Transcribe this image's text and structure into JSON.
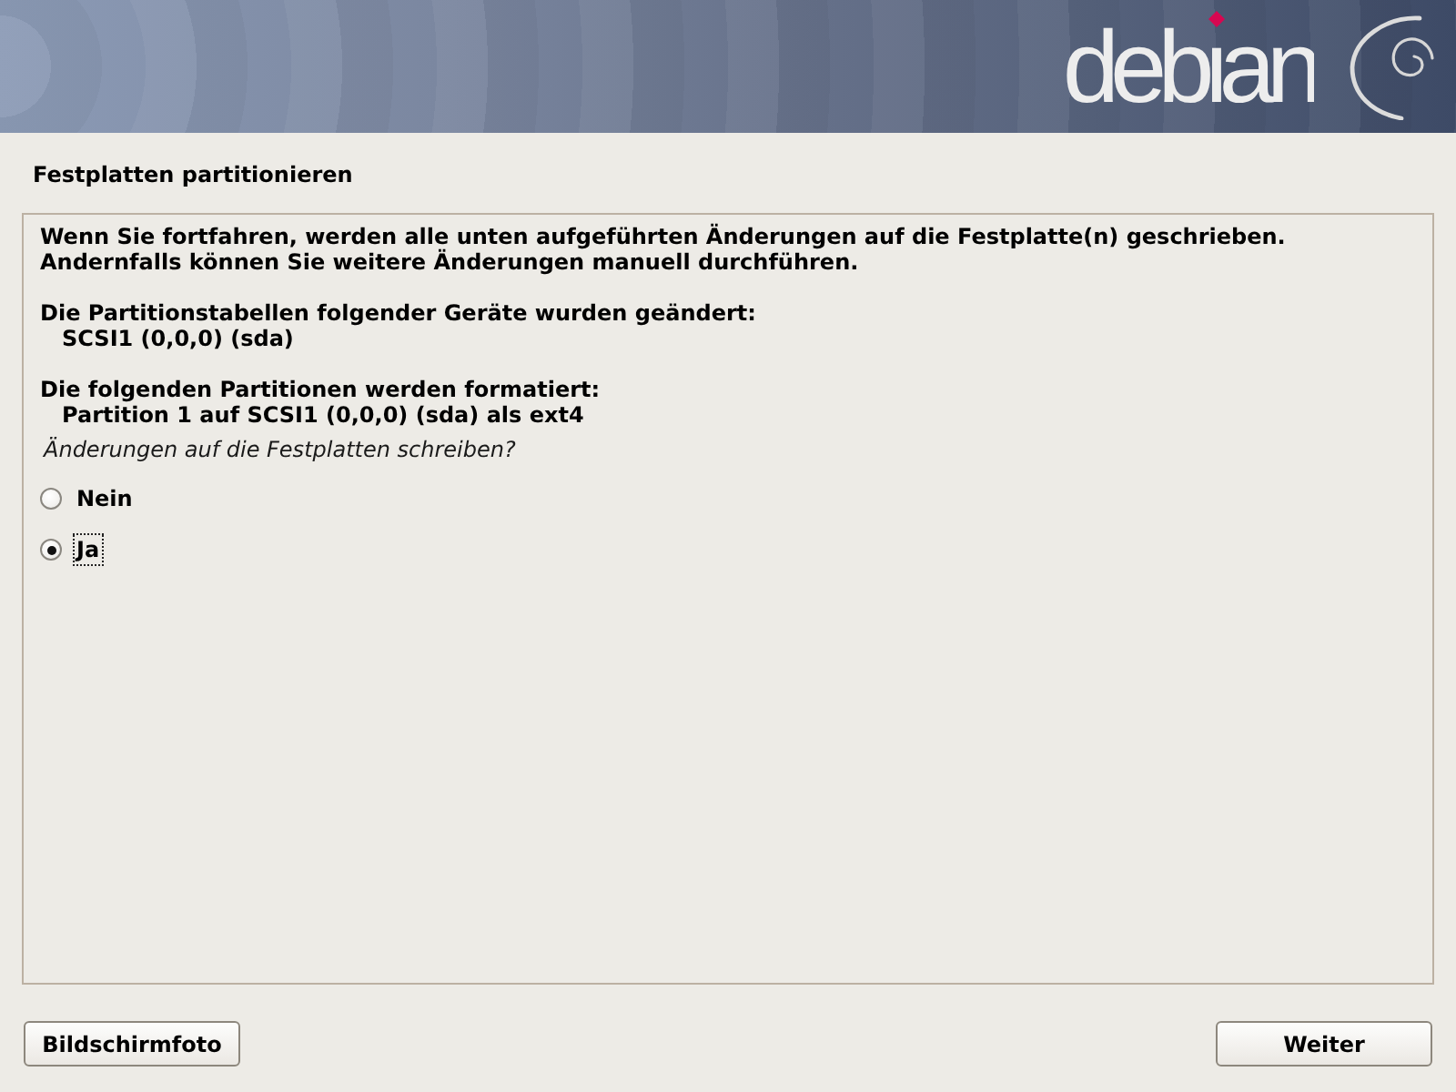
{
  "banner": {
    "logo_text": "debian"
  },
  "title": "Festplatten partitionieren",
  "panel": {
    "intro": "Wenn Sie fortfahren, werden alle unten aufgeführten Änderungen auf die Festplatte(n) geschrieben. Andernfalls können Sie weitere Änderungen manuell durchführen.",
    "sections": [
      {
        "heading": "Die Partitionstabellen folgender Geräte wurden geändert:",
        "items": [
          "SCSI1 (0,0,0) (sda)"
        ]
      },
      {
        "heading": "Die folgenden Partitionen werden formatiert:",
        "items": [
          "Partition 1 auf SCSI1 (0,0,0) (sda) als ext4"
        ]
      }
    ],
    "question": "Änderungen auf die Festplatten schreiben?",
    "options": [
      {
        "label": "Nein",
        "selected": false,
        "focused": false
      },
      {
        "label": "Ja",
        "selected": true,
        "focused": true
      }
    ]
  },
  "buttons": {
    "screenshot": "Bildschirmfoto",
    "continue": "Weiter"
  }
}
